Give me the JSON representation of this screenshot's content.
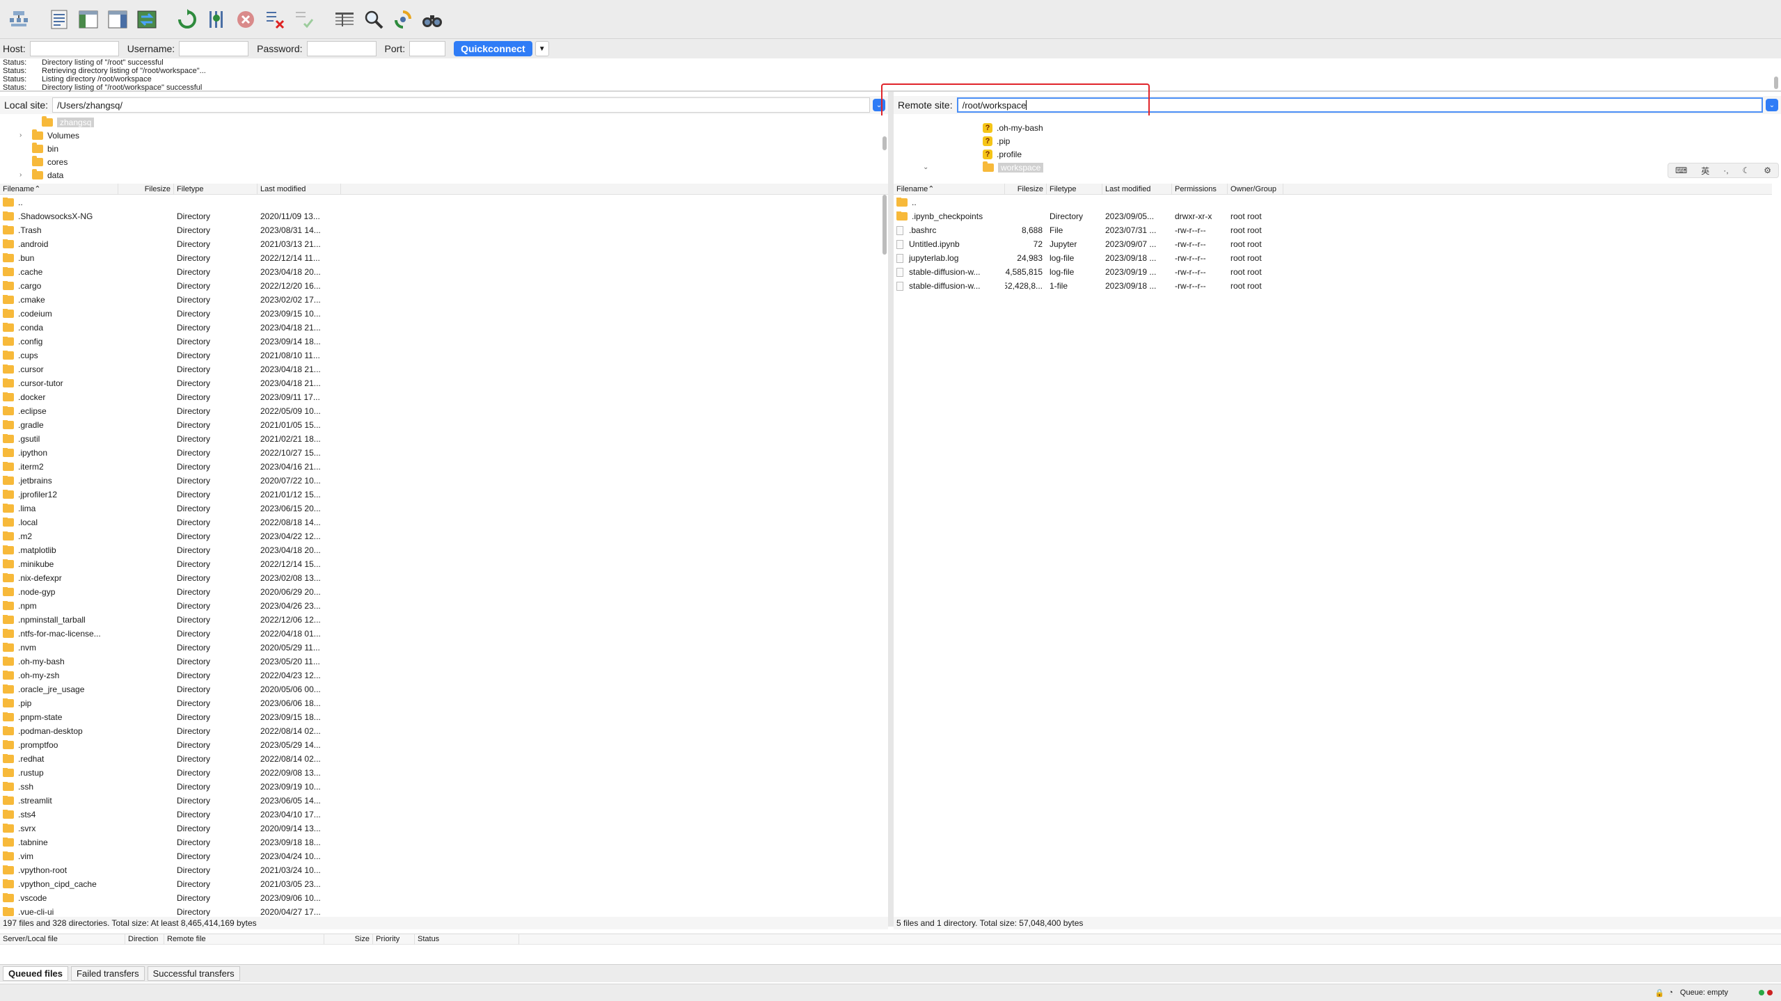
{
  "toolbar": {
    "icons": [
      "site-manager-icon",
      "toggle-message-log-icon",
      "toggle-local-tree-icon",
      "toggle-remote-tree-icon",
      "toggle-transfer-queue-icon",
      "refresh-icon",
      "process-queue-icon",
      "cancel-icon",
      "disconnect-icon",
      "reconnect-icon",
      "directory-filter-icon",
      "search-remote-icon",
      "sync-browsing-icon",
      "find-files-icon"
    ]
  },
  "quickconnect": {
    "host_label": "Host:",
    "username_label": "Username:",
    "password_label": "Password:",
    "port_label": "Port:",
    "button_label": "Quickconnect",
    "host_value": "",
    "username_value": "",
    "password_value": "",
    "port_value": ""
  },
  "messages": [
    {
      "type": "Status:",
      "text": "Directory listing of \"/root\" successful"
    },
    {
      "type": "Status:",
      "text": "Retrieving directory listing of \"/root/workspace\"..."
    },
    {
      "type": "Status:",
      "text": "Listing directory /root/workspace"
    },
    {
      "type": "Status:",
      "text": "Directory listing of \"/root/workspace\" successful"
    }
  ],
  "local": {
    "site_label": "Local site:",
    "path": "/Users/zhangsq/",
    "tree": [
      {
        "label": "zhangsq",
        "selected": true,
        "indent": 60,
        "caret": ""
      },
      {
        "label": "Volumes",
        "selected": false,
        "indent": 46,
        "caret": "›"
      },
      {
        "label": "bin",
        "selected": false,
        "indent": 46,
        "caret": ""
      },
      {
        "label": "cores",
        "selected": false,
        "indent": 46,
        "caret": ""
      },
      {
        "label": "data",
        "selected": false,
        "indent": 46,
        "caret": "›"
      }
    ],
    "headers": [
      "Filename",
      "Filesize",
      "Filetype",
      "Last modified"
    ],
    "rows": [
      [
        "..",
        "",
        "",
        ""
      ],
      [
        ".ShadowsocksX-NG",
        "",
        "Directory",
        "2020/11/09 13..."
      ],
      [
        ".Trash",
        "",
        "Directory",
        "2023/08/31 14..."
      ],
      [
        ".android",
        "",
        "Directory",
        "2021/03/13 21..."
      ],
      [
        ".bun",
        "",
        "Directory",
        "2022/12/14 11..."
      ],
      [
        ".cache",
        "",
        "Directory",
        "2023/04/18 20..."
      ],
      [
        ".cargo",
        "",
        "Directory",
        "2022/12/20 16..."
      ],
      [
        ".cmake",
        "",
        "Directory",
        "2023/02/02 17..."
      ],
      [
        ".codeium",
        "",
        "Directory",
        "2023/09/15 10..."
      ],
      [
        ".conda",
        "",
        "Directory",
        "2023/04/18 21..."
      ],
      [
        ".config",
        "",
        "Directory",
        "2023/09/14 18..."
      ],
      [
        ".cups",
        "",
        "Directory",
        "2021/08/10 11..."
      ],
      [
        ".cursor",
        "",
        "Directory",
        "2023/04/18 21..."
      ],
      [
        ".cursor-tutor",
        "",
        "Directory",
        "2023/04/18 21..."
      ],
      [
        ".docker",
        "",
        "Directory",
        "2023/09/11 17..."
      ],
      [
        ".eclipse",
        "",
        "Directory",
        "2022/05/09 10..."
      ],
      [
        ".gradle",
        "",
        "Directory",
        "2021/01/05 15..."
      ],
      [
        ".gsutil",
        "",
        "Directory",
        "2021/02/21 18..."
      ],
      [
        ".ipython",
        "",
        "Directory",
        "2022/10/27 15..."
      ],
      [
        ".iterm2",
        "",
        "Directory",
        "2023/04/16 21..."
      ],
      [
        ".jetbrains",
        "",
        "Directory",
        "2020/07/22 10..."
      ],
      [
        ".jprofiler12",
        "",
        "Directory",
        "2021/01/12 15..."
      ],
      [
        ".lima",
        "",
        "Directory",
        "2023/06/15 20..."
      ],
      [
        ".local",
        "",
        "Directory",
        "2022/08/18 14..."
      ],
      [
        ".m2",
        "",
        "Directory",
        "2023/04/22 12..."
      ],
      [
        ".matplotlib",
        "",
        "Directory",
        "2023/04/18 20..."
      ],
      [
        ".minikube",
        "",
        "Directory",
        "2022/12/14 15..."
      ],
      [
        ".nix-defexpr",
        "",
        "Directory",
        "2023/02/08 13..."
      ],
      [
        ".node-gyp",
        "",
        "Directory",
        "2020/06/29 20..."
      ],
      [
        ".npm",
        "",
        "Directory",
        "2023/04/26 23..."
      ],
      [
        ".npminstall_tarball",
        "",
        "Directory",
        "2022/12/06 12..."
      ],
      [
        ".ntfs-for-mac-license...",
        "",
        "Directory",
        "2022/04/18 01..."
      ],
      [
        ".nvm",
        "",
        "Directory",
        "2020/05/29 11..."
      ],
      [
        ".oh-my-bash",
        "",
        "Directory",
        "2023/05/20 11..."
      ],
      [
        ".oh-my-zsh",
        "",
        "Directory",
        "2022/04/23 12..."
      ],
      [
        ".oracle_jre_usage",
        "",
        "Directory",
        "2020/05/06 00..."
      ],
      [
        ".pip",
        "",
        "Directory",
        "2023/06/06 18..."
      ],
      [
        ".pnpm-state",
        "",
        "Directory",
        "2023/09/15 18..."
      ],
      [
        ".podman-desktop",
        "",
        "Directory",
        "2022/08/14 02..."
      ],
      [
        ".promptfoo",
        "",
        "Directory",
        "2023/05/29 14..."
      ],
      [
        ".redhat",
        "",
        "Directory",
        "2022/08/14 02..."
      ],
      [
        ".rustup",
        "",
        "Directory",
        "2022/09/08 13..."
      ],
      [
        ".ssh",
        "",
        "Directory",
        "2023/09/19 10..."
      ],
      [
        ".streamlit",
        "",
        "Directory",
        "2023/06/05 14..."
      ],
      [
        ".sts4",
        "",
        "Directory",
        "2023/04/10 17..."
      ],
      [
        ".svrx",
        "",
        "Directory",
        "2020/09/14 13..."
      ],
      [
        ".tabnine",
        "",
        "Directory",
        "2023/09/18 18..."
      ],
      [
        ".vim",
        "",
        "Directory",
        "2023/04/24 10..."
      ],
      [
        ".vpython-root",
        "",
        "Directory",
        "2021/03/24 10..."
      ],
      [
        ".vpython_cipd_cache",
        "",
        "Directory",
        "2021/03/05 23..."
      ],
      [
        ".vscode",
        "",
        "Directory",
        "2023/09/06 10..."
      ],
      [
        ".vue-cli-ui",
        "",
        "Directory",
        "2020/04/27 17..."
      ]
    ],
    "status": "197 files and 328 directories. Total size: At least 8,465,414,169 bytes"
  },
  "remote": {
    "site_label": "Remote site:",
    "path": "/root/workspace",
    "tree": [
      {
        "label": ".oh-my-bash",
        "kind": "unknown",
        "indent": 64
      },
      {
        "label": ".pip",
        "kind": "unknown",
        "indent": 64
      },
      {
        "label": ".profile",
        "kind": "unknown",
        "indent": 64
      },
      {
        "label": "workspace",
        "kind": "folder-selected",
        "indent": 64
      }
    ],
    "headers": [
      "Filename",
      "Filesize",
      "Filetype",
      "Last modified",
      "Permissions",
      "Owner/Group"
    ],
    "rows": [
      [
        "..",
        "",
        "",
        "",
        "",
        "",
        "parent"
      ],
      [
        ".ipynb_checkpoints",
        "",
        "Directory",
        "2023/09/05...",
        "drwxr-xr-x",
        "root root",
        "folder"
      ],
      [
        ".bashrc",
        "8,688",
        "File",
        "2023/07/31 ...",
        "-rw-r--r--",
        "root root",
        "file"
      ],
      [
        "Untitled.ipynb",
        "72",
        "Jupyter",
        "2023/09/07 ...",
        "-rw-r--r--",
        "root root",
        "file"
      ],
      [
        "jupyterlab.log",
        "24,983",
        "log-file",
        "2023/09/18 ...",
        "-rw-r--r--",
        "root root",
        "file"
      ],
      [
        "stable-diffusion-w...",
        "4,585,815",
        "log-file",
        "2023/09/19 ...",
        "-rw-r--r--",
        "root root",
        "file"
      ],
      [
        "stable-diffusion-w...",
        "52,428,8...",
        "1-file",
        "2023/09/18 ...",
        "-rw-r--r--",
        "root root",
        "file"
      ]
    ],
    "status": "5 files and 1 directory. Total size: 57,048,400 bytes"
  },
  "ime": {
    "items": [
      "⌨",
      "英",
      "·,",
      "☾",
      "⚙"
    ]
  },
  "queue": {
    "headers": [
      "Server/Local file",
      "Direction",
      "Remote file",
      "Size",
      "Priority",
      "Status"
    ],
    "tabs": [
      "Queued files",
      "Failed transfers",
      "Successful transfers"
    ]
  },
  "statusbar": {
    "queue_text": "Queue: empty"
  },
  "colors": {
    "accent": "#2f7cf6",
    "highlight": "#e0242a",
    "folder": "#f7b93a"
  }
}
